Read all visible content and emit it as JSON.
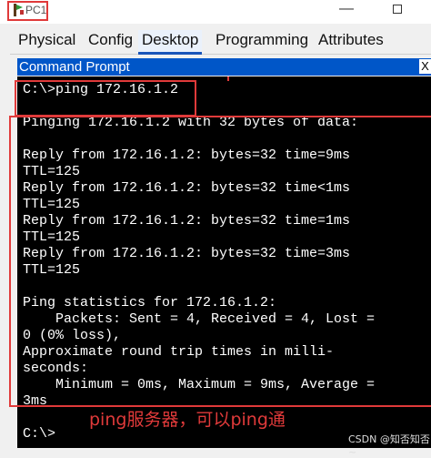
{
  "window": {
    "title": "PC1"
  },
  "tabs": [
    "Physical",
    "Config",
    "Desktop",
    "Programming",
    "Attributes"
  ],
  "active_tab": "Desktop",
  "command_prompt": {
    "title": "Command Prompt",
    "close_label": "X",
    "lines": [
      "C:\\>ping 172.16.1.2",
      "",
      "Pinging 172.16.1.2 with 32 bytes of data:",
      "",
      "Reply from 172.16.1.2: bytes=32 time=9ms",
      "TTL=125",
      "Reply from 172.16.1.2: bytes=32 time<1ms",
      "TTL=125",
      "Reply from 172.16.1.2: bytes=32 time=1ms",
      "TTL=125",
      "Reply from 172.16.1.2: bytes=32 time=3ms",
      "TTL=125",
      "",
      "Ping statistics for 172.16.1.2:",
      "    Packets: Sent = 4, Received = 4, Lost =",
      "0 (0% loss),",
      "Approximate round trip times in milli-",
      "seconds:",
      "    Minimum = 0ms, Maximum = 9ms, Average =",
      "3ms",
      "",
      "C:\\>"
    ]
  },
  "annotation": "ping服务器，可以ping通",
  "watermark": "CSDN @知否知否~",
  "colors": {
    "accent": "#0056c8",
    "annotation": "#e03a3a",
    "terminal_bg": "#000000"
  }
}
